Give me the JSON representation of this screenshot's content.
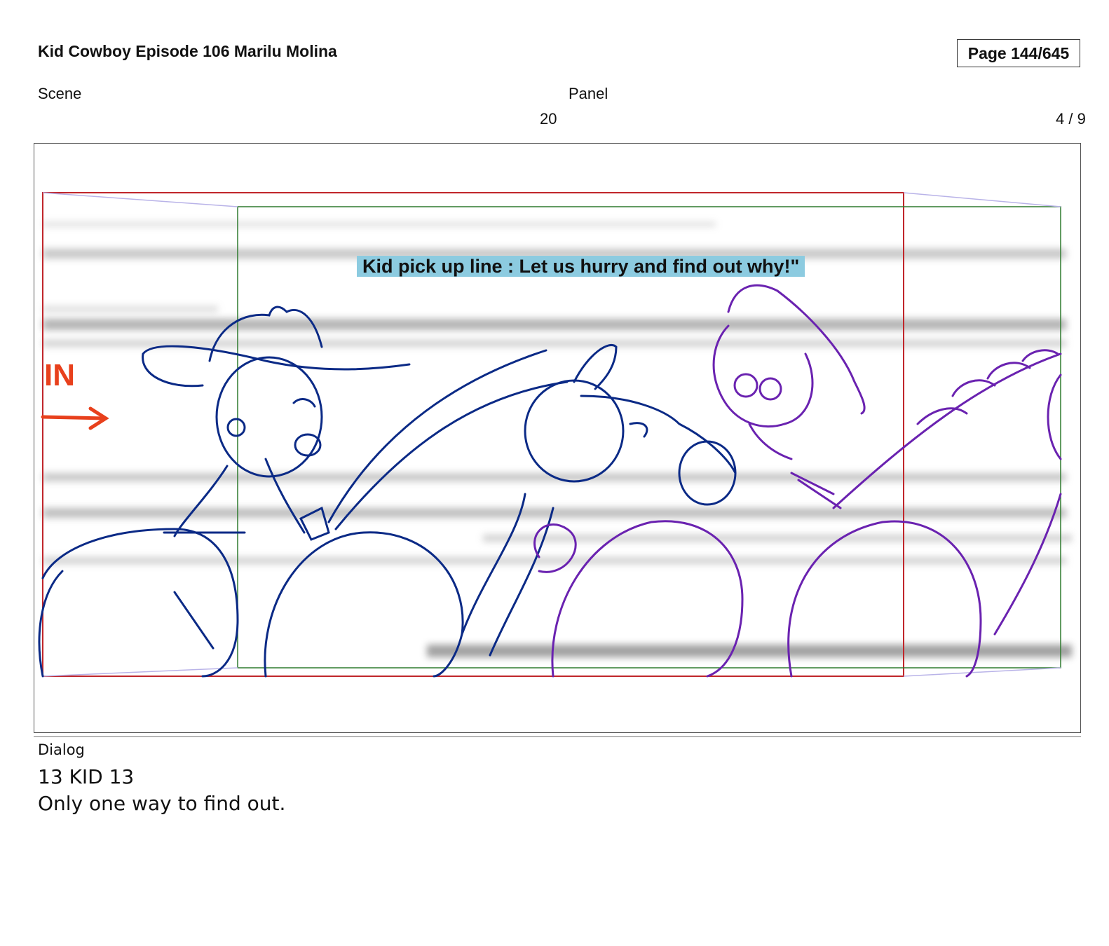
{
  "header": {
    "title": "Kid Cowboy Episode 106 Marilu Molina",
    "page": "Page 144/645",
    "scene_label": "Scene",
    "scene_value": "20",
    "panel_label": "Panel",
    "panel_value": "4 / 9"
  },
  "panel": {
    "caption": "Kid pick up line : Let us hurry and find out why!\"",
    "arrow_text": "IN"
  },
  "dialog": {
    "label": "Dialog",
    "speaker": "13 KID 13",
    "line": "Only one way to find out."
  },
  "colors": {
    "camera_frame": "#c0262b",
    "field_frame": "#2e7a2e",
    "sketch_blue": "#0b2a86",
    "sketch_purple": "#6a22b0",
    "caption_bg": "#8ccbe0",
    "arrow": "#e8401c"
  }
}
